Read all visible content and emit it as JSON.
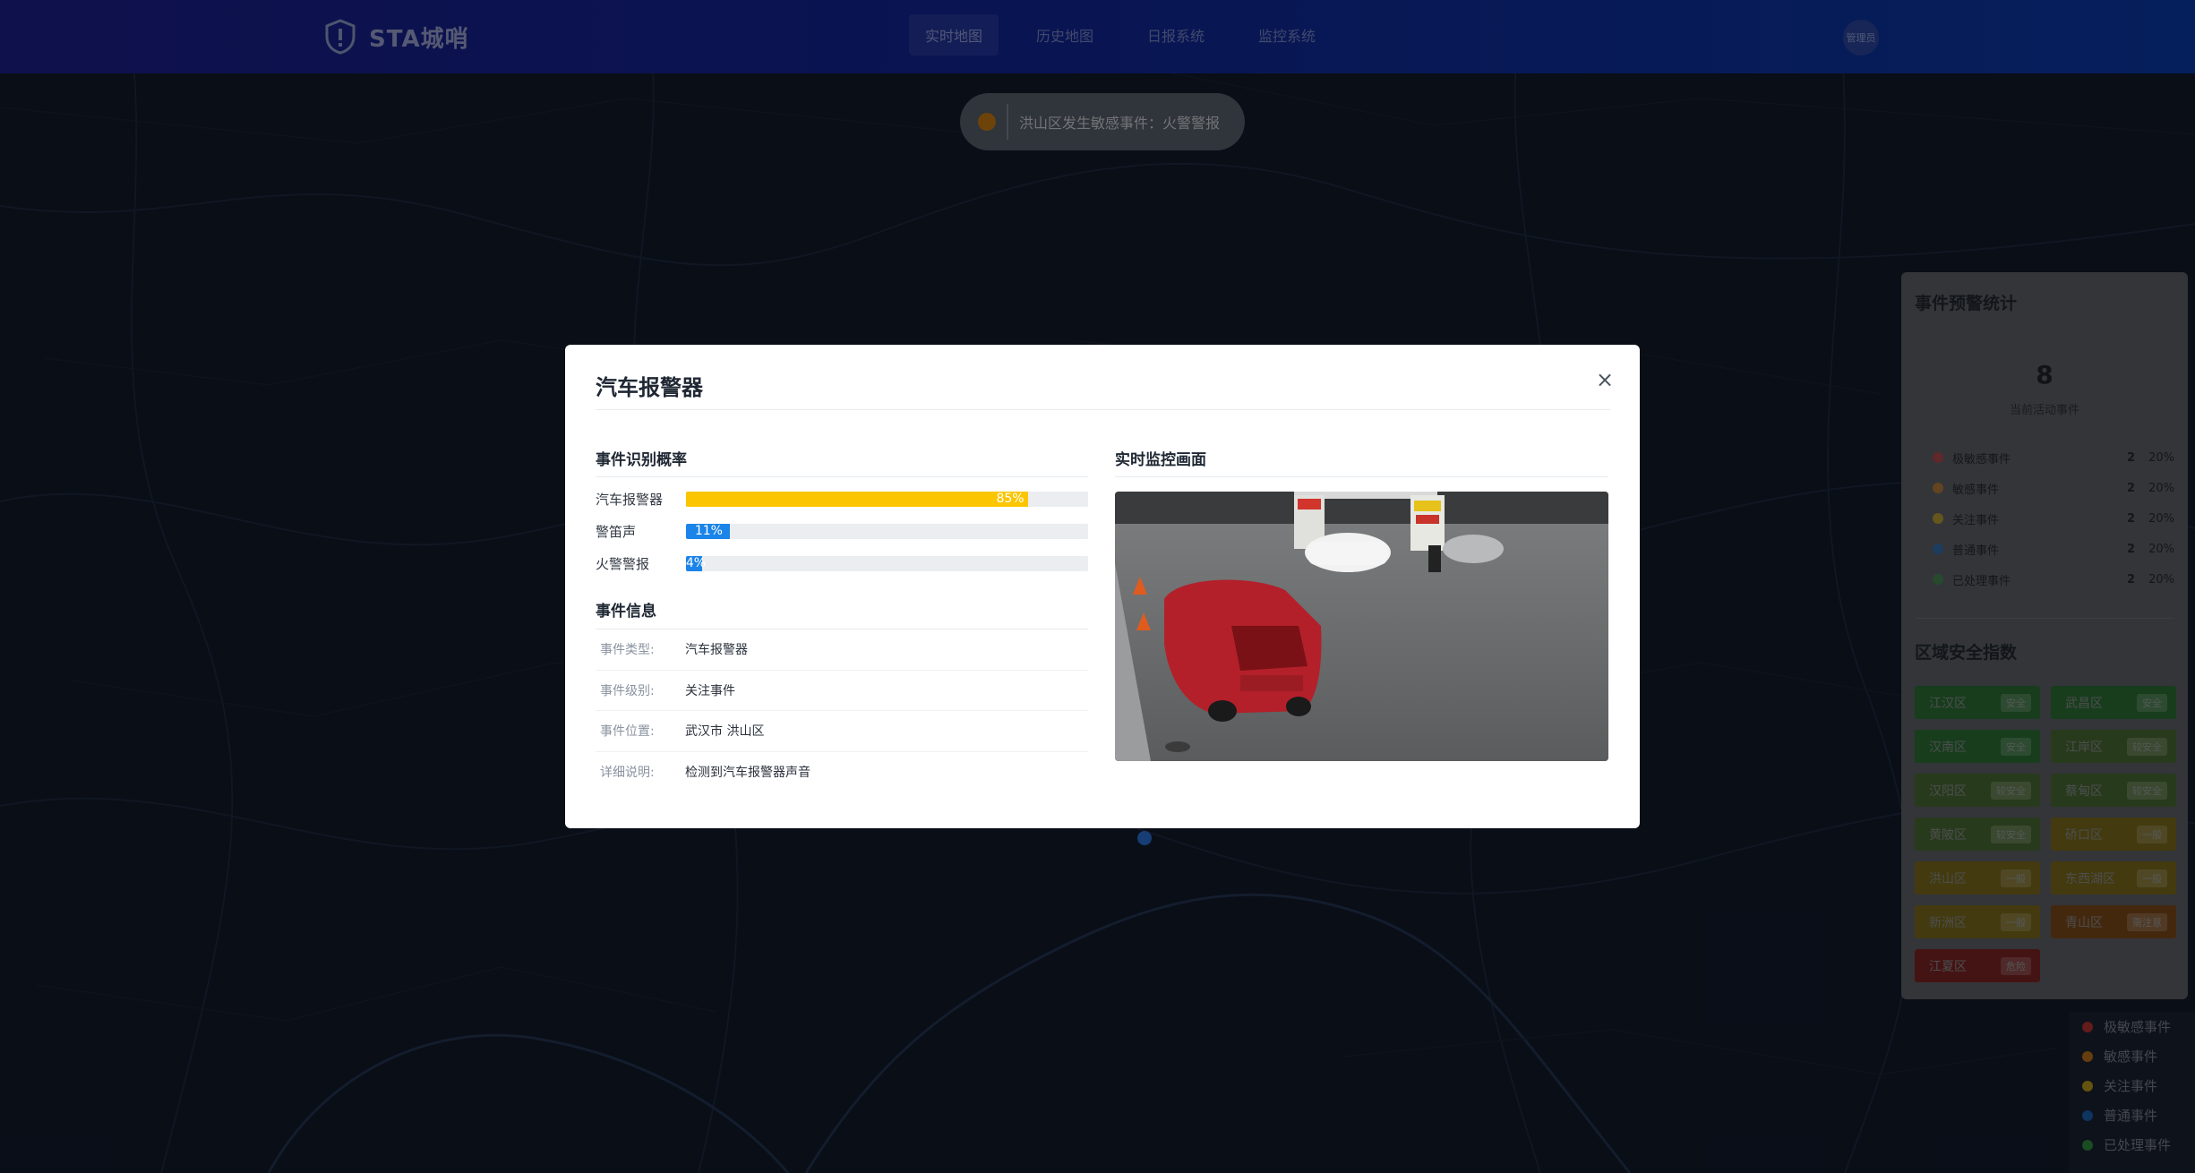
{
  "header": {
    "brand": "STA城哨",
    "nav": [
      "实时地图",
      "历史地图",
      "日报系统",
      "监控系统"
    ],
    "active_nav": "实时地图",
    "user": "管理员"
  },
  "toast": {
    "text": "洪山区发生敏感事件：火警警报",
    "dot_color": "#c77a12"
  },
  "modal": {
    "title": "汽车报警器",
    "close_glyph": "×",
    "prob_section": "事件识别概率",
    "probabilities": [
      {
        "label": "汽车报警器",
        "value": 85,
        "text": "85%",
        "color": "#fbc502"
      },
      {
        "label": "警笛声",
        "value": 11,
        "text": "11%",
        "color": "#1b84e8"
      },
      {
        "label": "火警警报",
        "value": 4,
        "text": "4%",
        "color": "#1b84e8"
      }
    ],
    "info_section": "事件信息",
    "info": [
      {
        "key": "事件类型:",
        "value": "汽车报警器"
      },
      {
        "key": "事件级别:",
        "value": "关注事件"
      },
      {
        "key": "事件位置:",
        "value": "武汉市 洪山区"
      },
      {
        "key": "详细说明:",
        "value": "检测到汽车报警器声音"
      }
    ],
    "camera_section": "实时监控画面"
  },
  "right_panel": {
    "stats_title": "事件预警统计",
    "active_count": "8",
    "active_label": "当前活动事件",
    "stats": [
      {
        "name": "极敏感事件",
        "count": "2",
        "pct": "20%",
        "color": "#e23b3b"
      },
      {
        "name": "敏感事件",
        "count": "2",
        "pct": "20%",
        "color": "#f08c1c"
      },
      {
        "name": "关注事件",
        "count": "2",
        "pct": "20%",
        "color": "#f5c518"
      },
      {
        "name": "普通事件",
        "count": "2",
        "pct": "20%",
        "color": "#1a76d8"
      },
      {
        "name": "已处理事件",
        "count": "2",
        "pct": "20%",
        "color": "#3aa24a"
      }
    ],
    "zones_title": "区域安全指数",
    "zones": [
      {
        "name": "江汉区",
        "status": "安全",
        "color": "#2c6f35"
      },
      {
        "name": "武昌区",
        "status": "安全",
        "color": "#2c6f35"
      },
      {
        "name": "汉南区",
        "status": "安全",
        "color": "#2c6f35"
      },
      {
        "name": "江岸区",
        "status": "较安全",
        "color": "#4a6b33"
      },
      {
        "name": "汉阳区",
        "status": "较安全",
        "color": "#4a6b33"
      },
      {
        "name": "蔡甸区",
        "status": "较安全",
        "color": "#4a6b33"
      },
      {
        "name": "黄陂区",
        "status": "较安全",
        "color": "#4a6b33"
      },
      {
        "name": "硚口区",
        "status": "一般",
        "color": "#7a6a1c"
      },
      {
        "name": "洪山区",
        "status": "一般",
        "color": "#7a6a1c"
      },
      {
        "name": "东西湖区",
        "status": "一般",
        "color": "#7a6a1c"
      },
      {
        "name": "新洲区",
        "status": "一般",
        "color": "#7a6a1c"
      },
      {
        "name": "青山区",
        "status": "需注意",
        "color": "#7d4a1b"
      },
      {
        "name": "江夏区",
        "status": "危险",
        "color": "#7c2526"
      }
    ]
  },
  "legend": [
    {
      "name": "极敏感事件",
      "color": "#b43232"
    },
    {
      "name": "敏感事件",
      "color": "#b8701c"
    },
    {
      "name": "关注事件",
      "color": "#b89a18"
    },
    {
      "name": "普通事件",
      "color": "#1a5fb0"
    },
    {
      "name": "已处理事件",
      "color": "#2f8a3d"
    }
  ]
}
